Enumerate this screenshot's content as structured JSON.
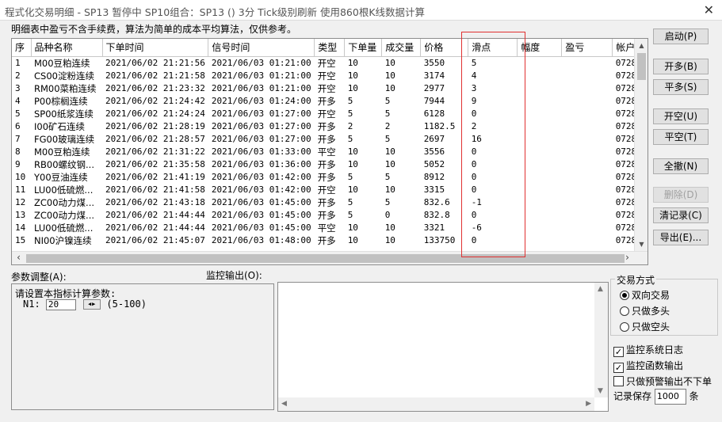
{
  "window": {
    "title": "程式化交易明细 - SP13 暂停中  SP10组合：SP13 () 3分 Tick级别刷新 使用860根K线数据计算",
    "close": "✕"
  },
  "notice": "明细表中盈亏不含手续费，算法为简单的成本平均算法，仅供参考。",
  "grid": {
    "columns": [
      "序",
      "品种名称",
      "下单时间",
      "信号时间",
      "类型",
      "下单量",
      "成交量",
      "价格",
      "滑点",
      "幅度",
      "盈亏",
      "帐户"
    ],
    "rows": [
      [
        "1",
        "M00豆粕连续",
        "2021/06/02 21:21:56",
        "2021/06/03 01:21:00",
        "开空",
        "10",
        "10",
        "3550",
        "5",
        "",
        "",
        "0728"
      ],
      [
        "2",
        "CS00淀粉连续",
        "2021/06/02 21:21:58",
        "2021/06/03 01:21:00",
        "开空",
        "10",
        "10",
        "3174",
        "4",
        "",
        "",
        "0728"
      ],
      [
        "3",
        "RM00菜粕连续",
        "2021/06/02 21:23:32",
        "2021/06/03 01:21:00",
        "开空",
        "10",
        "10",
        "2977",
        "3",
        "",
        "",
        "0728"
      ],
      [
        "4",
        "P00棕榈连续",
        "2021/06/02 21:24:42",
        "2021/06/03 01:24:00",
        "开多",
        "5",
        "5",
        "7944",
        "9",
        "",
        "",
        "0728"
      ],
      [
        "5",
        "SP00纸浆连续",
        "2021/06/02 21:24:24",
        "2021/06/03 01:27:00",
        "开空",
        "5",
        "5",
        "6128",
        "0",
        "",
        "",
        "0728"
      ],
      [
        "6",
        "I00矿石连续",
        "2021/06/02 21:28:19",
        "2021/06/03 01:27:00",
        "开多",
        "2",
        "2",
        "1182.5",
        "2",
        "",
        "",
        "0728"
      ],
      [
        "7",
        "FG00玻璃连续",
        "2021/06/02 21:28:57",
        "2021/06/03 01:27:00",
        "开多",
        "5",
        "5",
        "2697",
        "16",
        "",
        "",
        "0728"
      ],
      [
        "8",
        "M00豆粕连续",
        "2021/06/02 21:31:22",
        "2021/06/03 01:33:00",
        "平空",
        "10",
        "10",
        "3556",
        "0",
        "",
        "",
        "0728"
      ],
      [
        "9",
        "RB00螺纹钢...",
        "2021/06/02 21:35:58",
        "2021/06/03 01:36:00",
        "开多",
        "10",
        "10",
        "5052",
        "0",
        "",
        "",
        "0728"
      ],
      [
        "10",
        "Y00豆油连续",
        "2021/06/02 21:41:19",
        "2021/06/03 01:42:00",
        "开多",
        "5",
        "5",
        "8912",
        "0",
        "",
        "",
        "0728"
      ],
      [
        "11",
        "LU00低硫燃...",
        "2021/06/02 21:41:58",
        "2021/06/03 01:42:00",
        "开空",
        "10",
        "10",
        "3315",
        "0",
        "",
        "",
        "0728"
      ],
      [
        "12",
        "ZC00动力煤...",
        "2021/06/02 21:43:18",
        "2021/06/03 01:45:00",
        "开多",
        "5",
        "5",
        "832.6",
        "-1",
        "",
        "",
        "0728"
      ],
      [
        "13",
        "ZC00动力煤...",
        "2021/06/02 21:44:44",
        "2021/06/03 01:45:00",
        "开多",
        "5",
        "0",
        "832.8",
        "0",
        "",
        "",
        "0728"
      ],
      [
        "14",
        "LU00低硫燃...",
        "2021/06/02 21:44:44",
        "2021/06/03 01:45:00",
        "平空",
        "10",
        "10",
        "3321",
        "-6",
        "",
        "",
        "0728"
      ],
      [
        "15",
        "NI00沪镍连续",
        "2021/06/02 21:45:07",
        "2021/06/03 01:48:00",
        "开多",
        "10",
        "10",
        "133750",
        "0",
        "",
        "",
        "0728"
      ]
    ]
  },
  "buttons": {
    "start": "启动(P)",
    "open_long": "开多(B)",
    "close_long": "平多(S)",
    "open_short": "开空(U)",
    "close_short": "平空(T)",
    "close_all": "全撤(N)",
    "delete": "删除(D)",
    "clear": "清记录(C)",
    "export": "导出(E)..."
  },
  "params": {
    "title": "参数调整(A):",
    "prompt": "请设置本指标计算参数:",
    "n1_label": "N1:",
    "n1_value": "20",
    "n1_range": "(5-100)"
  },
  "monitor": {
    "title": "监控输出(O):"
  },
  "trade_mode": {
    "title": "交易方式",
    "options": [
      "双向交易",
      "只做多头",
      "只做空头"
    ],
    "selected": 0
  },
  "checks": {
    "sys_log": "监控系统日志",
    "func_output": "监控函数输出",
    "alert_only": "只做预警输出不下单",
    "sys_log_checked": "✓",
    "func_output_checked": "✓"
  },
  "record": {
    "label": "记录保存",
    "value": "1000",
    "unit": "条"
  }
}
